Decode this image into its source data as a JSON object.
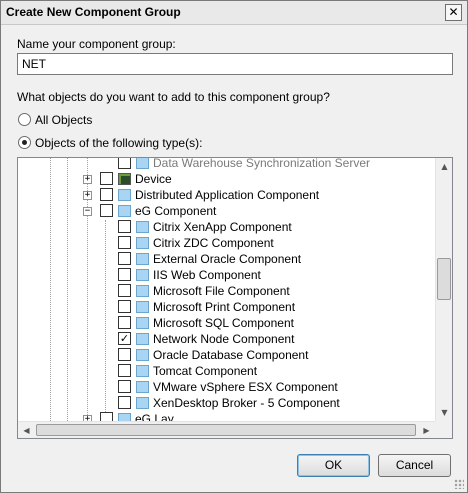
{
  "window": {
    "title": "Create New Component Group",
    "close_symbol": "✕"
  },
  "name_field": {
    "label": "Name your component group:",
    "value": "NET"
  },
  "question": "What objects do you want to add to this component group?",
  "radios": [
    {
      "label": "All Objects",
      "checked": false
    },
    {
      "label": "Objects of the following type(s):",
      "checked": true
    }
  ],
  "tree_items": [
    {
      "label": "Data Warehouse Synchronization Server",
      "checked": false,
      "expander": "",
      "icon": "component-icon"
    },
    {
      "label": "Device",
      "checked": false,
      "expander": "+",
      "icon": "device-icon"
    },
    {
      "label": "Distributed Application Component",
      "checked": false,
      "expander": "+",
      "icon": "component-icon"
    },
    {
      "label": "eG Component",
      "checked": false,
      "expander": "−",
      "icon": "component-icon"
    },
    {
      "label": "Citrix XenApp Component",
      "checked": false,
      "expander": "",
      "icon": "component-icon"
    },
    {
      "label": "Citrix ZDC Component",
      "checked": false,
      "expander": "",
      "icon": "component-icon"
    },
    {
      "label": "External Oracle Component",
      "checked": false,
      "expander": "",
      "icon": "component-icon"
    },
    {
      "label": "IIS Web Component",
      "checked": false,
      "expander": "",
      "icon": "component-icon"
    },
    {
      "label": "Microsoft File Component",
      "checked": false,
      "expander": "",
      "icon": "component-icon"
    },
    {
      "label": "Microsoft Print Component",
      "checked": false,
      "expander": "",
      "icon": "component-icon"
    },
    {
      "label": "Microsoft SQL Component",
      "checked": false,
      "expander": "",
      "icon": "component-icon"
    },
    {
      "label": "Network Node Component",
      "checked": true,
      "expander": "",
      "icon": "component-icon"
    },
    {
      "label": "Oracle Database Component",
      "checked": false,
      "expander": "",
      "icon": "component-icon"
    },
    {
      "label": "Tomcat Component",
      "checked": false,
      "expander": "",
      "icon": "component-icon"
    },
    {
      "label": "VMware vSphere ESX Component",
      "checked": false,
      "expander": "",
      "icon": "component-icon"
    },
    {
      "label": "XenDesktop Broker - 5 Component",
      "checked": false,
      "expander": "",
      "icon": "component-icon"
    },
    {
      "label": "eG Lay...",
      "checked": false,
      "expander": "+",
      "icon": "component-icon"
    }
  ],
  "checkmark": "✓",
  "scroll_arrows": {
    "up": "▲",
    "down": "▼",
    "left": "◀",
    "right": "▶"
  },
  "buttons": {
    "ok": "OK",
    "cancel": "Cancel"
  }
}
